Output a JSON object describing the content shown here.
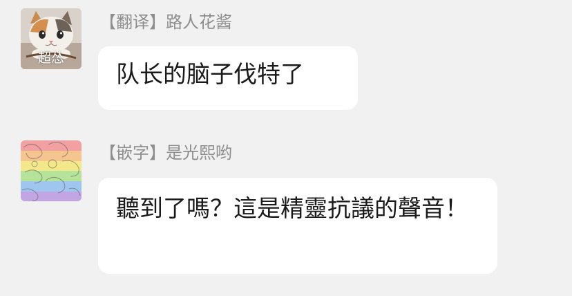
{
  "messages": [
    {
      "sender": "【翻译】路人花酱",
      "avatar_caption": "超怂",
      "avatar_icon": "cat-photo",
      "text": "队长的脑子伐特了"
    },
    {
      "sender": "【嵌字】是光熙哟",
      "avatar_icon": "rainbow-floral-pattern",
      "text": "聽到了嗎？這是精靈抗議的聲音！"
    }
  ],
  "colors": {
    "background": "#f1f1f1",
    "bubble": "#ffffff",
    "sender_text": "#8e8e8e",
    "message_text": "#1a1a1a"
  }
}
